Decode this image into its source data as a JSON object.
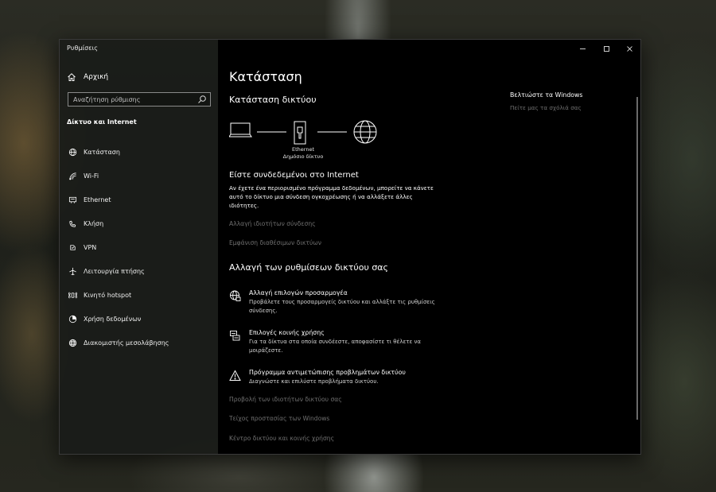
{
  "window": {
    "app_title": "Ρυθμίσεις"
  },
  "sidebar": {
    "home_label": "Αρχική",
    "search_placeholder": "Αναζήτηση ρύθμισης",
    "section_title": "Δίκτυο και Internet",
    "items": [
      {
        "label": "Κατάσταση",
        "icon": "status-globe-icon"
      },
      {
        "label": "Wi-Fi",
        "icon": "wifi-icon"
      },
      {
        "label": "Ethernet",
        "icon": "ethernet-icon"
      },
      {
        "label": "Κλήση",
        "icon": "dialup-icon"
      },
      {
        "label": "VPN",
        "icon": "vpn-icon"
      },
      {
        "label": "Λειτουργία πτήσης",
        "icon": "airplane-icon"
      },
      {
        "label": "Κινητό hotspot",
        "icon": "hotspot-icon"
      },
      {
        "label": "Χρήση δεδομένων",
        "icon": "data-usage-icon"
      },
      {
        "label": "Διακομιστής μεσολάβησης",
        "icon": "proxy-globe-icon"
      }
    ]
  },
  "main": {
    "page_title": "Κατάσταση",
    "network_status_title": "Κατάσταση δικτύου",
    "connection_name": "Ethernet",
    "connection_type": "Δημόσιο δίκτυο",
    "connected_title": "Είστε συνδεδεμένοι στο Internet",
    "connected_desc": "Αν έχετε ένα περιορισμένο πρόγραμμα δεδομένων, μπορείτε να κάνετε αυτό το δίκτυο μια σύνδεση ογκοχρέωσης ή να αλλάξετε άλλες ιδιότητες.",
    "link_change_properties": "Αλλαγή ιδιοτήτων σύνδεσης",
    "link_show_networks": "Εμφάνιση διαθέσιμων δικτύων",
    "change_settings_title": "Αλλαγή των ρυθμίσεων δικτύου σας",
    "options": [
      {
        "title": "Αλλαγή επιλογών προσαρμογέα",
        "desc": "Προβάλετε τους προσαρμογείς δικτύου και αλλάξτε τις ρυθμίσεις σύνδεσης."
      },
      {
        "title": "Επιλογές κοινής χρήσης",
        "desc": "Για τα δίκτυα στα οποία συνδέεστε, αποφασίστε τι θέλετε να μοιράζεστε."
      },
      {
        "title": "Πρόγραμμα αντιμετώπισης προβλημάτων δικτύου",
        "desc": "Διαγνώστε και επιλύστε προβλήματα δικτύου."
      }
    ],
    "bottom_links": [
      "Προβολή των ιδιοτήτων δικτύου σας",
      "Τείχος προστασίας των Windows",
      "Κέντρο δικτύου και κοινής χρήσης"
    ],
    "side_title": "Βελτιώστε τα Windows",
    "side_link": "Πείτε μας τα σχόλιά σας"
  },
  "colors": {
    "sidebar_bg": "#1a1c19",
    "main_bg": "#000000",
    "link_gray": "#6f6f6f"
  }
}
